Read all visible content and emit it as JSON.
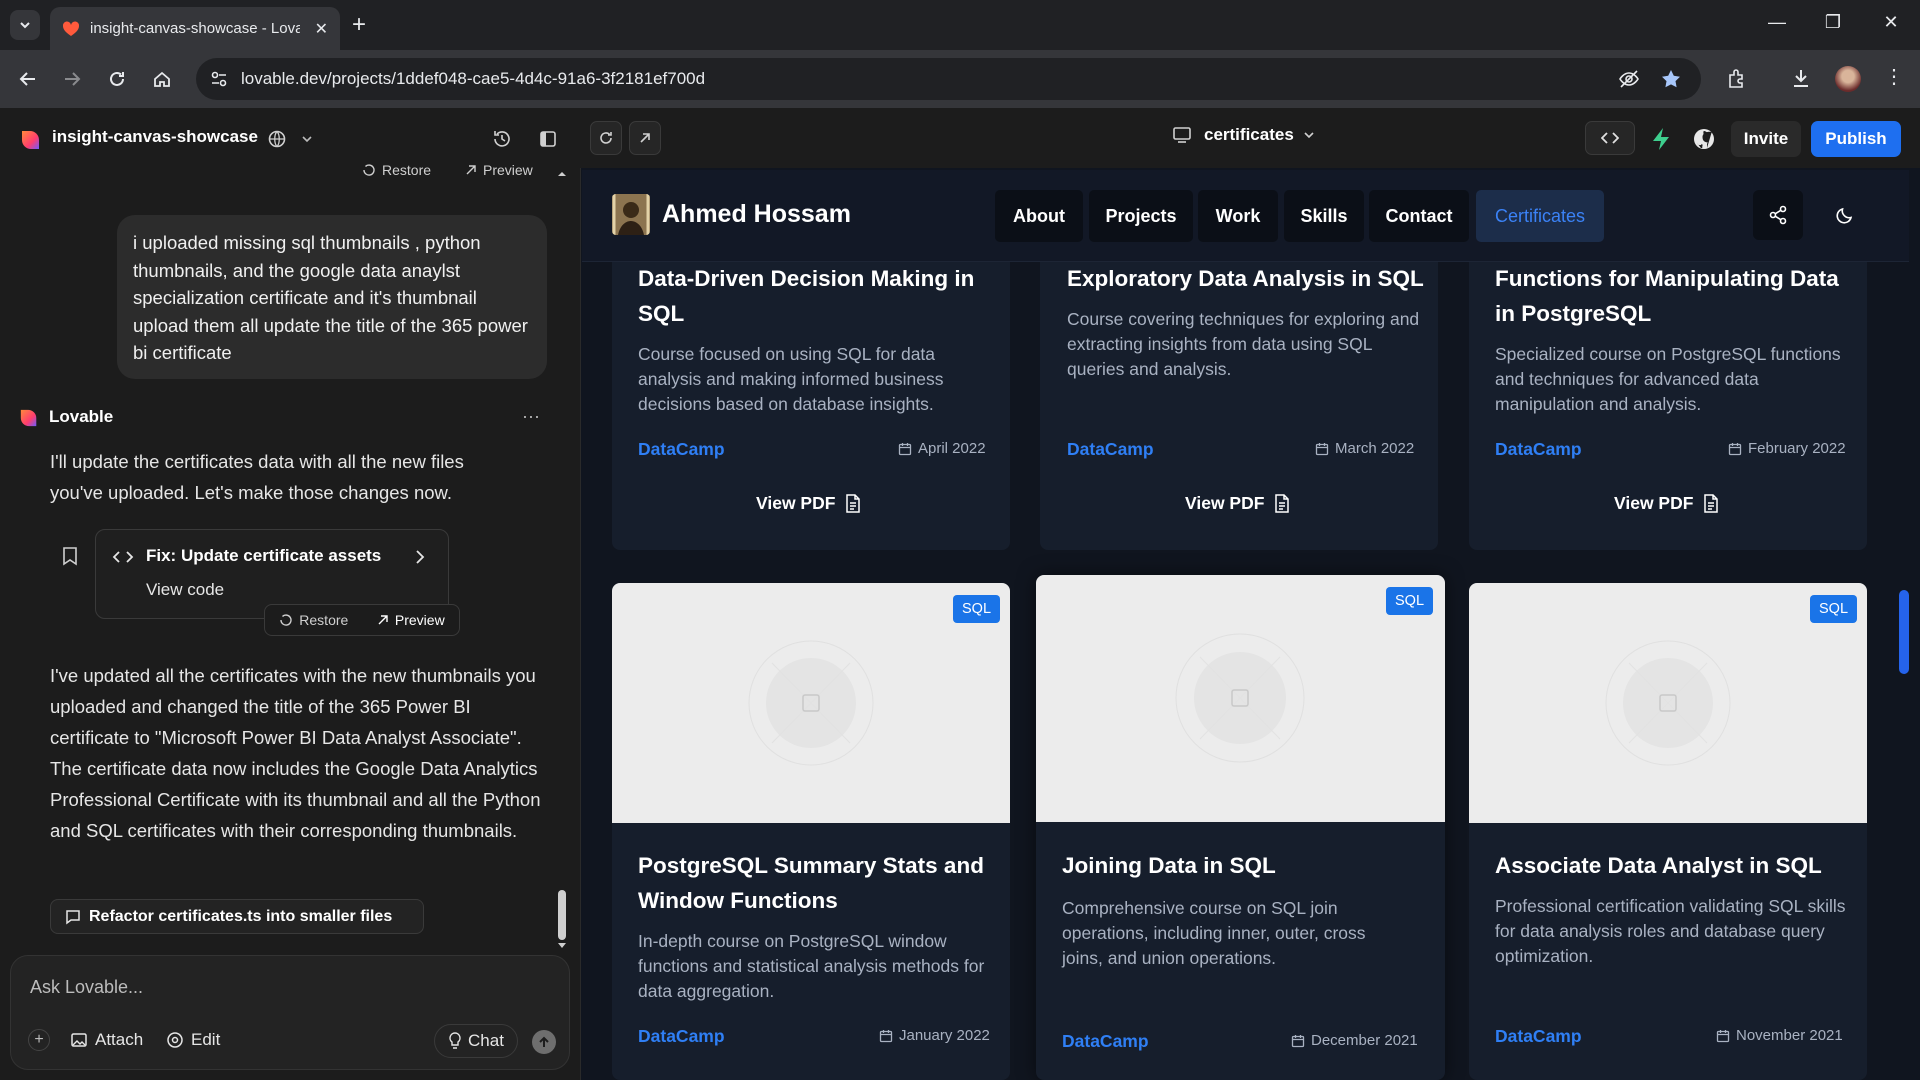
{
  "browser": {
    "tab_title": "insight-canvas-showcase - Lova",
    "url": "lovable.dev/projects/1ddef048-cae5-4d4c-91a6-3f2181ef700d"
  },
  "app_header": {
    "project_name": "insight-canvas-showcase",
    "page_select": "certificates",
    "invite_label": "Invite",
    "publish_label": "Publish"
  },
  "chat": {
    "top_restore": "Restore",
    "top_preview": "Preview",
    "user_message": "i uploaded missing sql thumbnails , python thumbnails, and the google data anaylst specialization certificate and it's thumbnail upload them all update the title of the 365 power bi certificate",
    "assistant_name": "Lovable",
    "assistant_intro": "I'll update the certificates data with all the new files you've uploaded. Let's make those changes now.",
    "fix_title": "Fix: Update certificate assets",
    "view_code": "View code",
    "restore_label": "Restore",
    "preview_label": "Preview",
    "assistant_summary": "I've updated all the certificates with the new thumbnails you uploaded and changed the title of the 365 Power BI certificate to \"Microsoft Power BI Data Analyst Associate\". The certificate data now includes the Google Data Analytics Professional Certificate with its thumbnail and all the Python and SQL certificates with their corresponding thumbnails.",
    "suggestion": "Refactor certificates.ts into smaller files",
    "input_placeholder": "Ask Lovable...",
    "attach_label": "Attach",
    "edit_label": "Edit",
    "chat_label": "Chat"
  },
  "site": {
    "brand": "Ahmed Hossam",
    "nav": [
      "About",
      "Projects",
      "Work",
      "Skills",
      "Contact",
      "Certificates"
    ],
    "view_pdf": "View PDF",
    "badge": "SQL",
    "row1": [
      {
        "title": "Data-Driven Decision Making in SQL",
        "desc": "Course focused on using SQL for data analysis and making informed business decisions based on database insights.",
        "issuer": "DataCamp",
        "date": "April 2022"
      },
      {
        "title": "Exploratory Data Analysis in SQL",
        "desc": "Course covering techniques for exploring and extracting insights from data using SQL queries and analysis.",
        "issuer": "DataCamp",
        "date": "March 2022"
      },
      {
        "title": "Functions for Manipulating Data in PostgreSQL",
        "desc": "Specialized course on PostgreSQL functions and techniques for advanced data manipulation and analysis.",
        "issuer": "DataCamp",
        "date": "February 2022"
      }
    ],
    "row2": [
      {
        "title": "PostgreSQL Summary Stats and Window Functions",
        "desc": "In-depth course on PostgreSQL window functions and statistical analysis methods for data aggregation.",
        "issuer": "DataCamp",
        "date": "January 2022"
      },
      {
        "title": "Joining Data in SQL",
        "desc": "Comprehensive course on SQL join operations, including inner, outer, cross joins, and union operations.",
        "issuer": "DataCamp",
        "date": "December 2021"
      },
      {
        "title": "Associate Data Analyst in SQL",
        "desc": "Professional certification validating SQL skills for data analysis roles and database query optimization.",
        "issuer": "DataCamp",
        "date": "November 2021"
      }
    ]
  },
  "colors": {
    "accent": "#1e6ff0",
    "link": "#2f7ff5",
    "card": "#161e2c",
    "preview_bg": "#10151f"
  }
}
